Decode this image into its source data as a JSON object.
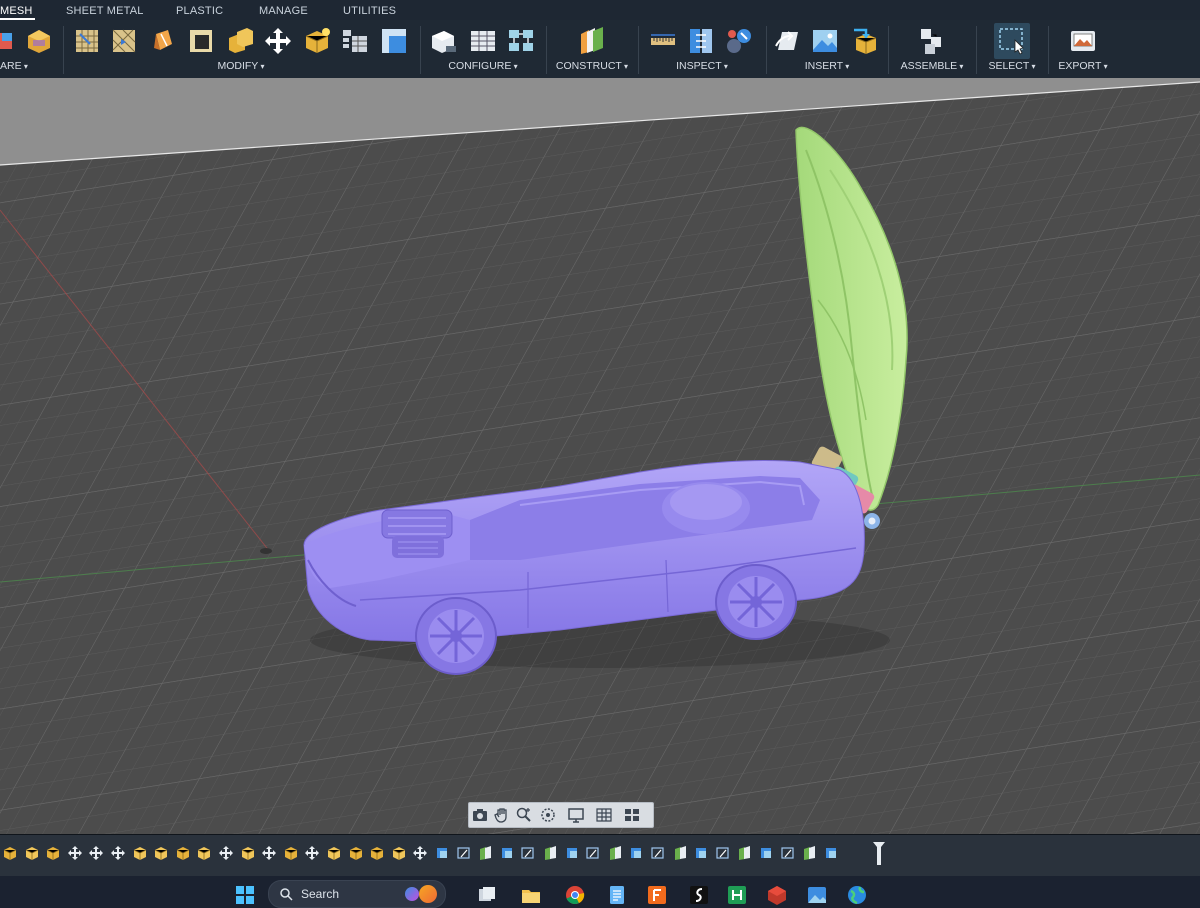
{
  "tabs": [
    "MESH",
    "SHEET METAL",
    "PLASTIC",
    "MANAGE",
    "UTILITIES"
  ],
  "active_tab": "MESH",
  "ribbon_groups": [
    {
      "id": "prepare",
      "label": "ARE"
    },
    {
      "id": "modify",
      "label": "MODIFY"
    },
    {
      "id": "configure",
      "label": "CONFIGURE"
    },
    {
      "id": "construct",
      "label": "CONSTRUCT"
    },
    {
      "id": "inspect",
      "label": "INSPECT"
    },
    {
      "id": "insert",
      "label": "INSERT"
    },
    {
      "id": "assemble",
      "label": "ASSEMBLE"
    },
    {
      "id": "select",
      "label": "SELECT"
    },
    {
      "id": "export",
      "label": "EXPORT"
    }
  ],
  "navbar": {
    "items": [
      "camera-icon",
      "pan-hand-icon",
      "zoom-icon",
      "orbit-icon",
      "display-settings-icon",
      "grid-settings-icon",
      "viewports-icon"
    ]
  },
  "taskbar": {
    "search_placeholder": "Search",
    "apps": [
      "windows-start-icon",
      "copilot-icon",
      "task-view-icon",
      "file-explorer-icon",
      "chrome-icon",
      "notepad-icon",
      "fusion-icon",
      "app-s-icon",
      "app-green-icon",
      "app-3d-icon",
      "photos-icon",
      "globe-icon"
    ]
  },
  "colors": {
    "ribbon_bg": "#1f2934",
    "viewport_bg": "#4a4a4a",
    "car_body": "#9b8cf2",
    "lid": "#b7e48e",
    "timeline_bg": "#2a323c",
    "taskbar_bg": "#1b2230"
  }
}
